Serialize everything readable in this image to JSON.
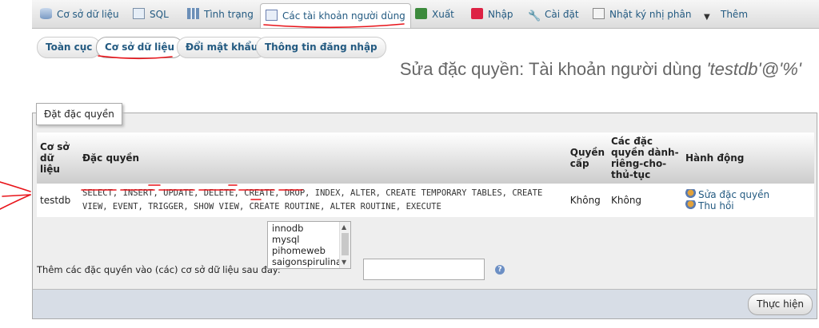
{
  "top_tabs": [
    {
      "label": "Cơ sở dữ liệu",
      "icon": "database-icon"
    },
    {
      "label": "SQL",
      "icon": "sql-icon"
    },
    {
      "label": "Tình trạng",
      "icon": "status-icon"
    },
    {
      "label": "Các tài khoản người dùng",
      "icon": "users-icon",
      "active": true
    },
    {
      "label": "Xuất",
      "icon": "export-icon"
    },
    {
      "label": "Nhập",
      "icon": "import-icon"
    },
    {
      "label": "Cài đặt",
      "icon": "settings-icon"
    },
    {
      "label": "Nhật ký nhị phân",
      "icon": "log-icon"
    },
    {
      "label": "Thêm",
      "icon": "dropdown-arrow-icon"
    }
  ],
  "sub_tabs": [
    {
      "label": "Toàn cục"
    },
    {
      "label": "Cơ sở dữ liệu",
      "active": true
    },
    {
      "label": "Đổi mật khẩu"
    },
    {
      "label": "Thông tin đăng nhập"
    }
  ],
  "page_title": {
    "prefix": "Sửa đặc quyền: Tài khoản người dùng ",
    "account": "'testdb'@'%'"
  },
  "fieldset": {
    "legend": "Đặt đặc quyền",
    "table": {
      "headers": [
        "Cơ sở dữ liệu",
        "Đặc quyền",
        "Quyền cấp",
        "Các đặc quyền dành-riêng-cho-thủ-tục",
        "Hành động"
      ],
      "rows": [
        {
          "database": "testdb",
          "privileges_line1": "SELECT, INSERT, UPDATE, DELETE, CREATE, DROP, INDEX, ALTER, CREATE TEMPORARY TABLES, CREATE",
          "privileges_line2": "VIEW, EVENT, TRIGGER, SHOW VIEW, CREATE ROUTINE, ALTER ROUTINE, EXECUTE",
          "grant": "Không",
          "routine": "Không",
          "edit_action": "Sửa đặc quyền",
          "revoke_action": "Thu hồi"
        }
      ]
    },
    "add_label": "Thêm các đặc quyền vào (các) cơ sở dữ liệu sau đây:",
    "database_list": [
      "innodb",
      "mysql",
      "pihomeweb",
      "saigonspirulina"
    ],
    "help_icon": "?",
    "go_button": "Thực hiện"
  },
  "colors": {
    "link": "#235a81",
    "annotation": "#e8141a",
    "panel": "#eeeeee"
  }
}
